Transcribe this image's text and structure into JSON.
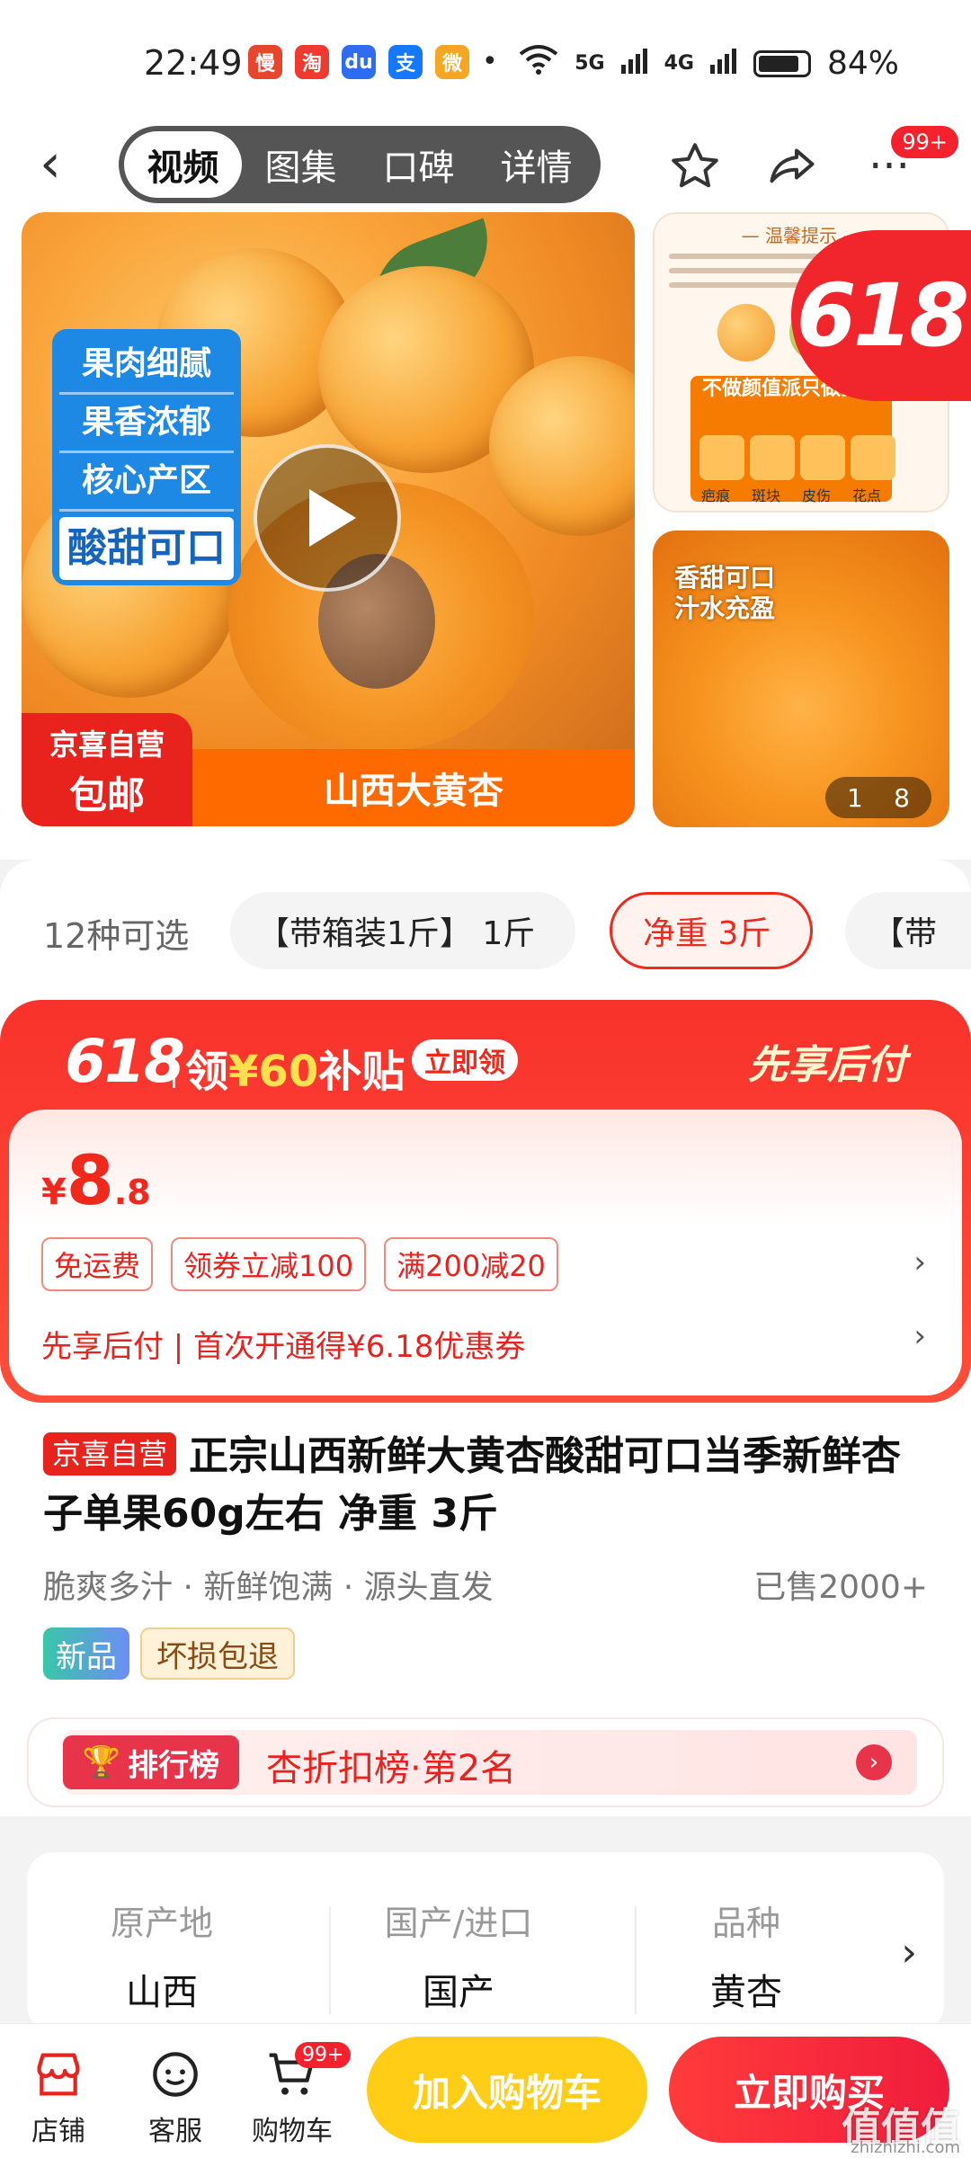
{
  "status_bar": {
    "time": "22:49",
    "apps": [
      {
        "icon": "app-icon-red",
        "glyph": "慢",
        "color": "#e8452f"
      },
      {
        "icon": "app-icon-taobao",
        "glyph": "淘",
        "color": "#f03a2f"
      },
      {
        "icon": "baidu-icon",
        "glyph": "du",
        "color": "#2e6cf2"
      },
      {
        "icon": "alipay-icon",
        "glyph": "支",
        "color": "#1677ff"
      },
      {
        "icon": "weibo-icon",
        "glyph": "微",
        "color": "#f5a623"
      }
    ],
    "signal_5g": "5G",
    "signal_4g": "4G",
    "battery": "84%"
  },
  "nav": {
    "tabs": [
      "视频",
      "图集",
      "口碑",
      "详情"
    ],
    "active_tab": 0,
    "more_badge": "99+"
  },
  "gallery": {
    "features": [
      "果肉细腻",
      "果香浓郁",
      "核心产区"
    ],
    "feature_highlight": "酸甜可口",
    "footer_label": "山西大黄杏",
    "shop_tag_line1": "京喜自营",
    "shop_tag_line2": "包邮",
    "thumb1_title": "— 温馨提示 —",
    "thumb1_warning": "不做颜值派只做实力",
    "thumb1_labels": [
      "疤痕",
      "斑块",
      "皮伤",
      "花点"
    ],
    "badge_618": "618",
    "thumb2_text_line1": "香甜可口",
    "thumb2_text_line2": "汁水充盈",
    "pager_current": "1",
    "pager_total": "8"
  },
  "spec": {
    "title": "12种可选",
    "options": [
      "【带箱装1斤】 1斤",
      "净重 3斤",
      "【带"
    ],
    "selected_index": 1
  },
  "promo": {
    "event": "618",
    "subsidy_prefix": "领",
    "subsidy_amount": "¥60",
    "subsidy_suffix": "补贴",
    "claim_label": "立即领",
    "pay_later": "先享后付",
    "price_currency": "¥",
    "price_int": "8",
    "price_dec": ".8",
    "coupons": [
      "免运费",
      "领券立减100",
      "满200减20"
    ],
    "pay_later_line": "先享后付 | 首次开通得¥6.18优惠券"
  },
  "product": {
    "shop_tag": "京喜自营",
    "title": "正宗山西新鲜大黄杏酸甜可口当季新鲜杏子单果60g左右 净重 3斤",
    "selling_points": "脆爽多汁 · 新鲜饱满 · 源头直发",
    "sold": "已售2000+",
    "tag_new": "新品",
    "tag_return": "坏损包退"
  },
  "rank": {
    "badge": "排行榜",
    "text": "杏折扣榜·第2名"
  },
  "attributes": [
    {
      "key": "原产地",
      "value": "山西"
    },
    {
      "key": "国产/进口",
      "value": "国产"
    },
    {
      "key": "品种",
      "value": "黄杏"
    }
  ],
  "bottom": {
    "shop": "店铺",
    "service": "客服",
    "cart": "购物车",
    "cart_badge": "99+",
    "add_to_cart": "加入购物车",
    "buy_now": "立即购买"
  },
  "watermark": {
    "text": "值值值",
    "url": "zhizhizhi.com"
  },
  "colors": {
    "accent_red": "#f1291d",
    "cart_yellow": "#ffcc16",
    "buy_red": "#f01d3c"
  }
}
